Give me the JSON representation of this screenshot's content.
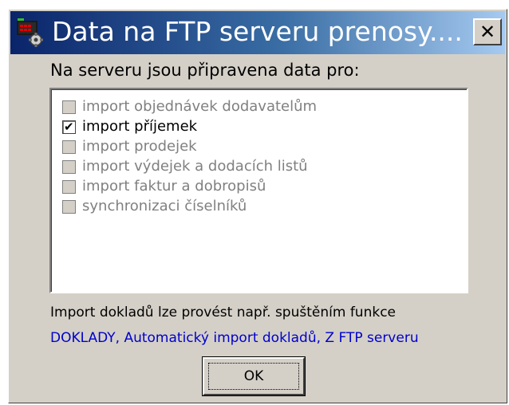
{
  "window": {
    "title": "Data na FTP serveru  prenosy....",
    "close_label": "✕"
  },
  "header_label": "Na serveru jsou připravena data pro:",
  "list": {
    "items": [
      {
        "label": "import objednávek dodavatelům",
        "checked": false,
        "enabled": false
      },
      {
        "label": "import příjemek",
        "checked": true,
        "enabled": true
      },
      {
        "label": "import prodejek",
        "checked": false,
        "enabled": false
      },
      {
        "label": "import výdejek a dodacích listů",
        "checked": false,
        "enabled": false
      },
      {
        "label": "import faktur a dobropisů",
        "checked": false,
        "enabled": false
      },
      {
        "label": "synchronizaci číselníků",
        "checked": false,
        "enabled": false
      }
    ]
  },
  "info": {
    "line1": "Import dokladů lze provést např. spuštěním funkce",
    "line2": "DOKLADY, Automatický import dokladů, Z FTP serveru"
  },
  "ok_label": "OK",
  "colors": {
    "title_bar_start": "#0a246a",
    "title_bar_end": "#a6caf0",
    "dialog_face": "#d4d0c8",
    "link_blue": "#0000cc",
    "disabled_text": "#808080"
  }
}
